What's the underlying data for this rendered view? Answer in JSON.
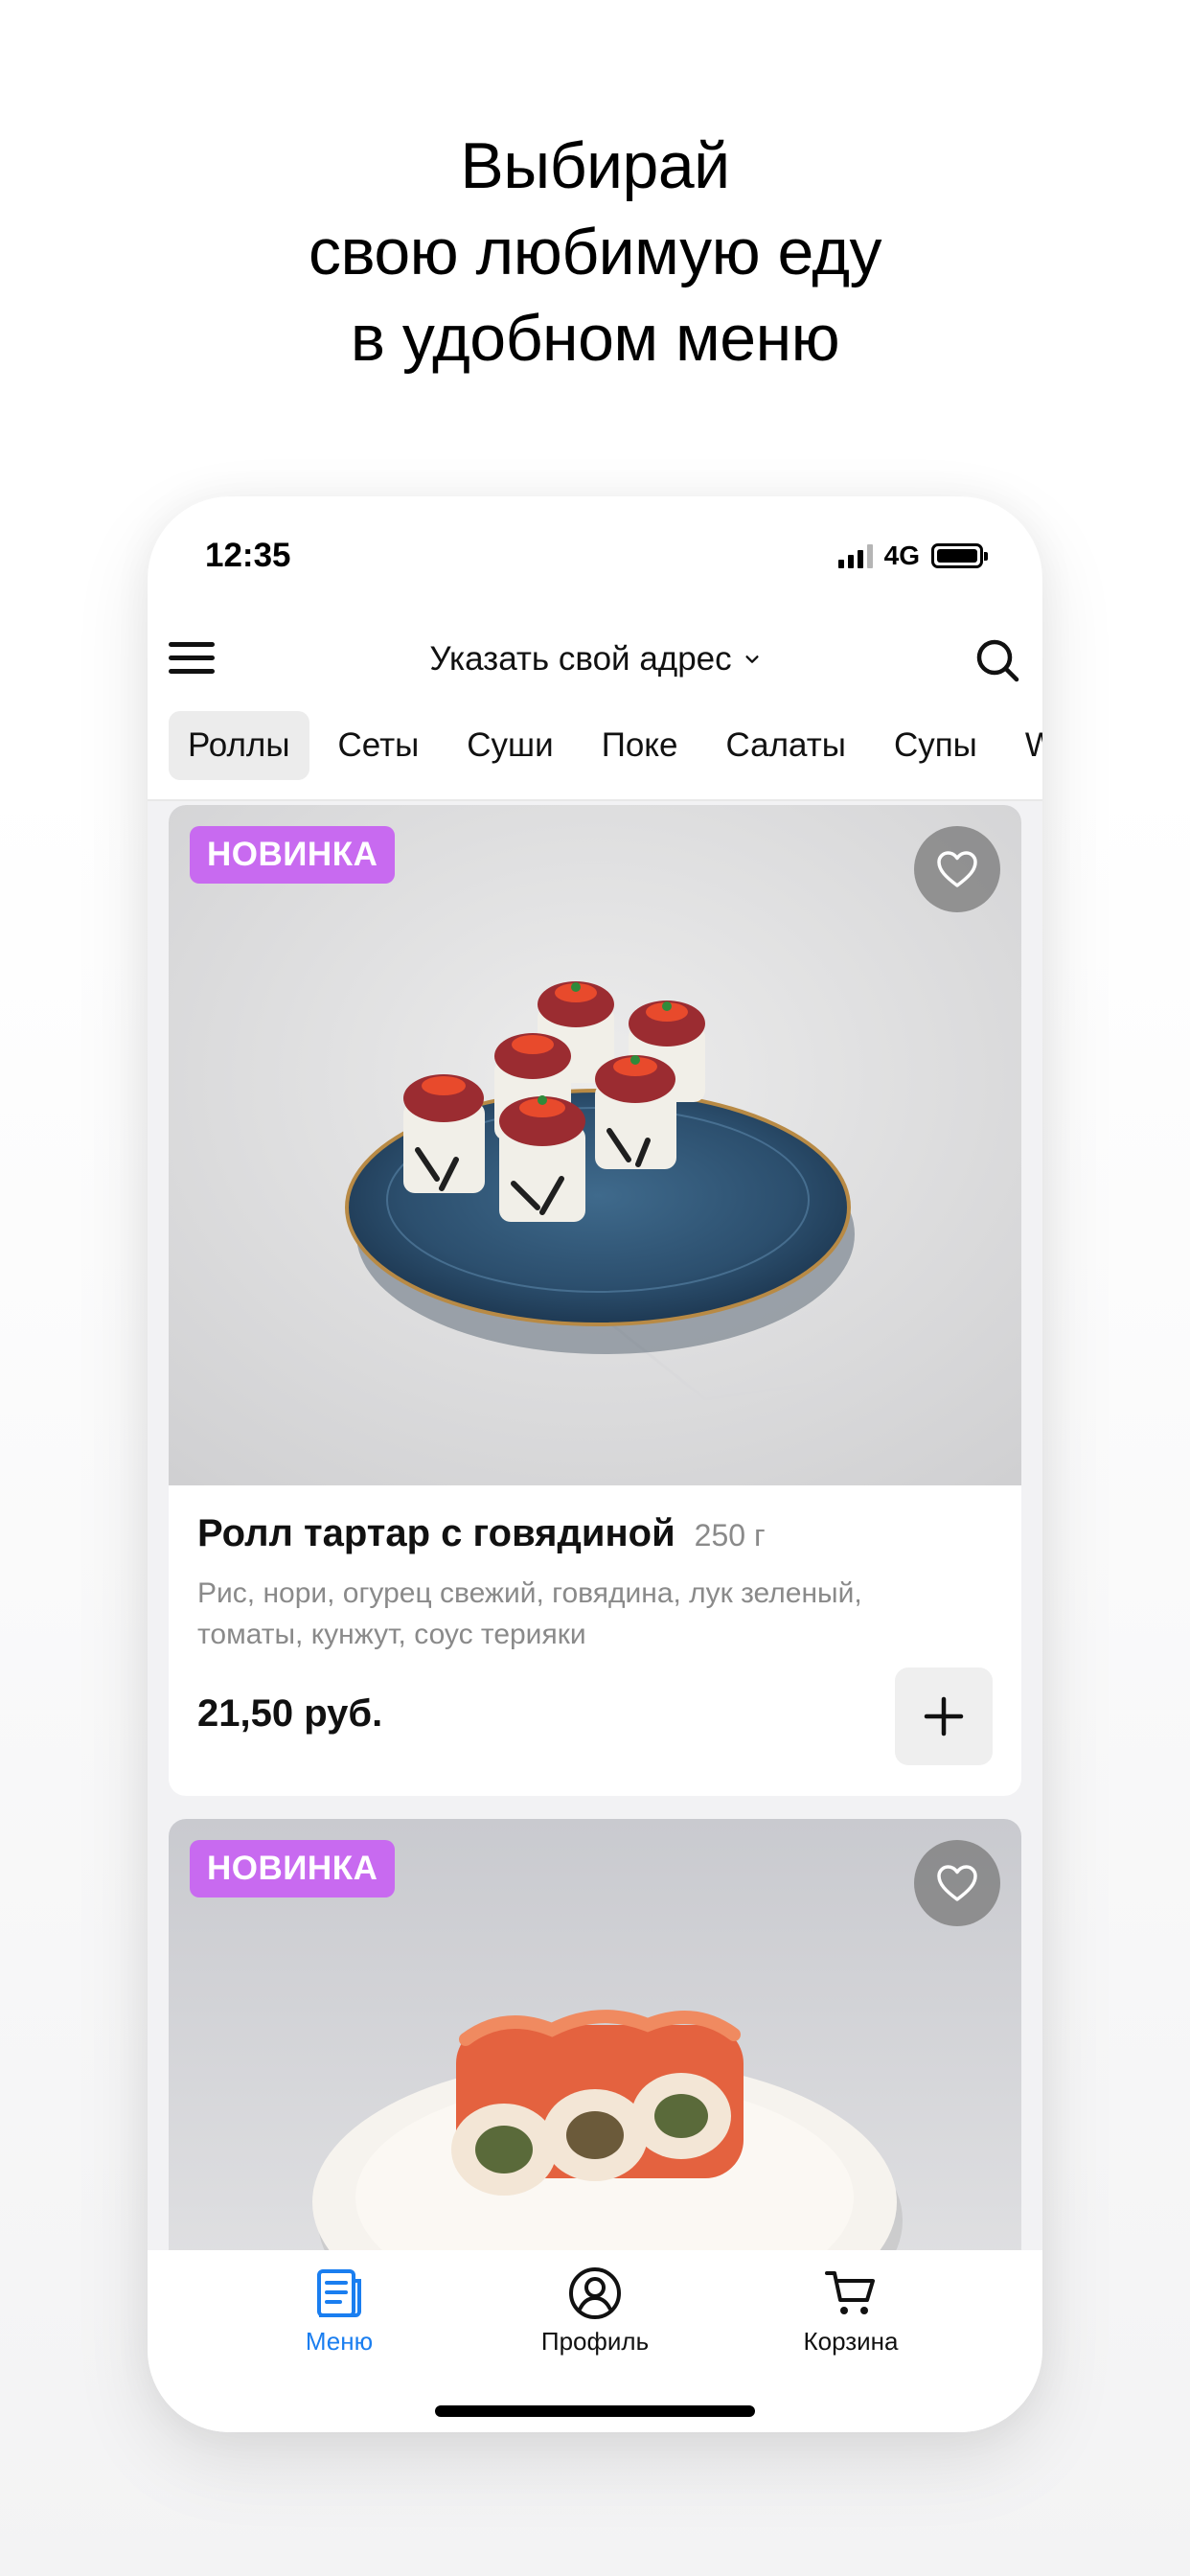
{
  "headline": {
    "line1": "Выбирай",
    "line2": "свою любимую еду",
    "line3": "в удобном меню"
  },
  "status_bar": {
    "time": "12:35",
    "network": "4G",
    "icons": [
      "signal-icon",
      "battery-icon"
    ]
  },
  "top_bar": {
    "menu_icon": "menu-icon",
    "address_label": "Указать свой адрес",
    "address_chevron_icon": "chevron-down-icon",
    "search_icon": "search-icon"
  },
  "categories": {
    "selected": "Роллы",
    "items": [
      "Роллы",
      "Сеты",
      "Суши",
      "Поке",
      "Салаты",
      "Супы",
      "WOK"
    ]
  },
  "products": [
    {
      "badge": "НОВИНКА",
      "favorite_icon": "heart-icon",
      "name": "Ролл тартар с говядиной",
      "weight": "250 г",
      "description": "Рис, нори, огурец свежий, говядина, лук зеленый, томаты, кунжут, соус терияки",
      "price": "21,50 руб.",
      "add_icon": "plus-icon",
      "photo": "beef-tartare-rolls-photo"
    },
    {
      "badge": "НОВИНКА",
      "favorite_icon": "heart-icon",
      "photo": "salmon-rolls-photo"
    }
  ],
  "bottom_nav": {
    "items": [
      {
        "label": "Меню",
        "icon": "menu-book-icon",
        "active": true
      },
      {
        "label": "Профиль",
        "icon": "profile-icon",
        "active": false
      },
      {
        "label": "Корзина",
        "icon": "cart-icon",
        "active": false
      }
    ]
  },
  "colors": {
    "badge": "#c86af0",
    "active_nav": "#1a7ef0",
    "feed_background": "#f2f2f4"
  }
}
